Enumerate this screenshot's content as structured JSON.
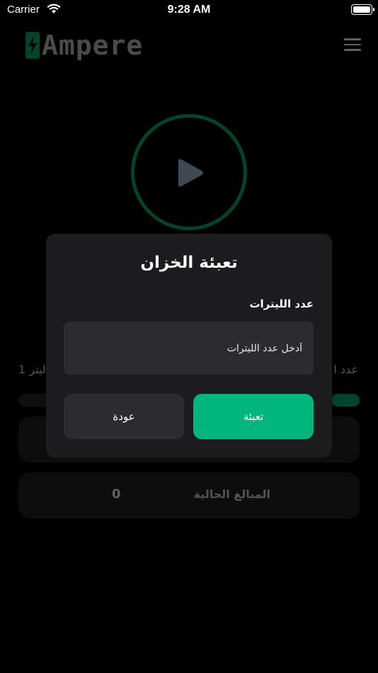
{
  "status_bar": {
    "carrier": "Carrier",
    "time": "9:28 AM"
  },
  "header": {
    "brand": "Ampere",
    "logo_icon": "lightning-bolt-icon",
    "menu_icon": "hamburger-menu-icon"
  },
  "player": {
    "icon": "play-icon"
  },
  "background": {
    "liters_label_fragment": "عدد ا",
    "liters_value_fragment": "1 ليتر",
    "progress_fraction": 0.08,
    "current_amount_label": "المبالغ الحالية",
    "current_amount_value": "0"
  },
  "modal": {
    "title": "تعبئة الخزان",
    "field_label": "عدد الليترات",
    "input_value": "",
    "input_placeholder": "أدخل عدد الليترات",
    "back_label": "عودة",
    "fill_label": "تعبئة"
  },
  "colors": {
    "accent": "#00b67a",
    "background": "#000000",
    "modal": "#1c1c1e",
    "input": "#2c2c2e"
  }
}
